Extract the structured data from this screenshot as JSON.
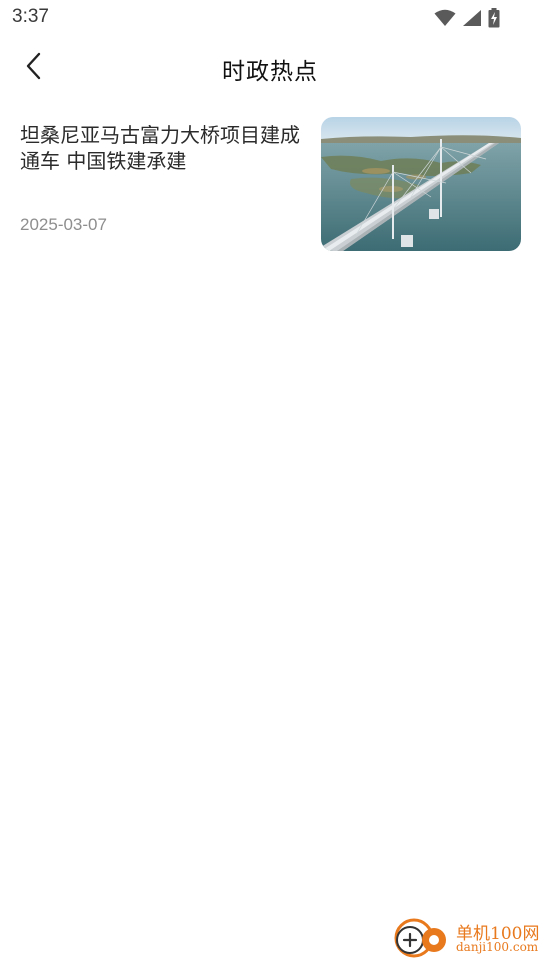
{
  "status_bar": {
    "time": "3:37",
    "icons": [
      "wifi-icon",
      "signal-icon",
      "battery-charging-icon"
    ]
  },
  "header": {
    "title": "时政热点",
    "back_icon": "chevron-left-icon"
  },
  "news": [
    {
      "title": "坦桑尼亚马古富力大桥项目建成通车 中国铁建承建",
      "date": "2025-03-07",
      "thumbnail": "bridge-aerial-photo"
    }
  ],
  "watermark": {
    "name": "单机100网",
    "domain": "danji100.com"
  },
  "colors": {
    "background": "#ffffff",
    "title_text": "#111111",
    "date_text": "#8e8e8e",
    "watermark": "#e8791d"
  }
}
